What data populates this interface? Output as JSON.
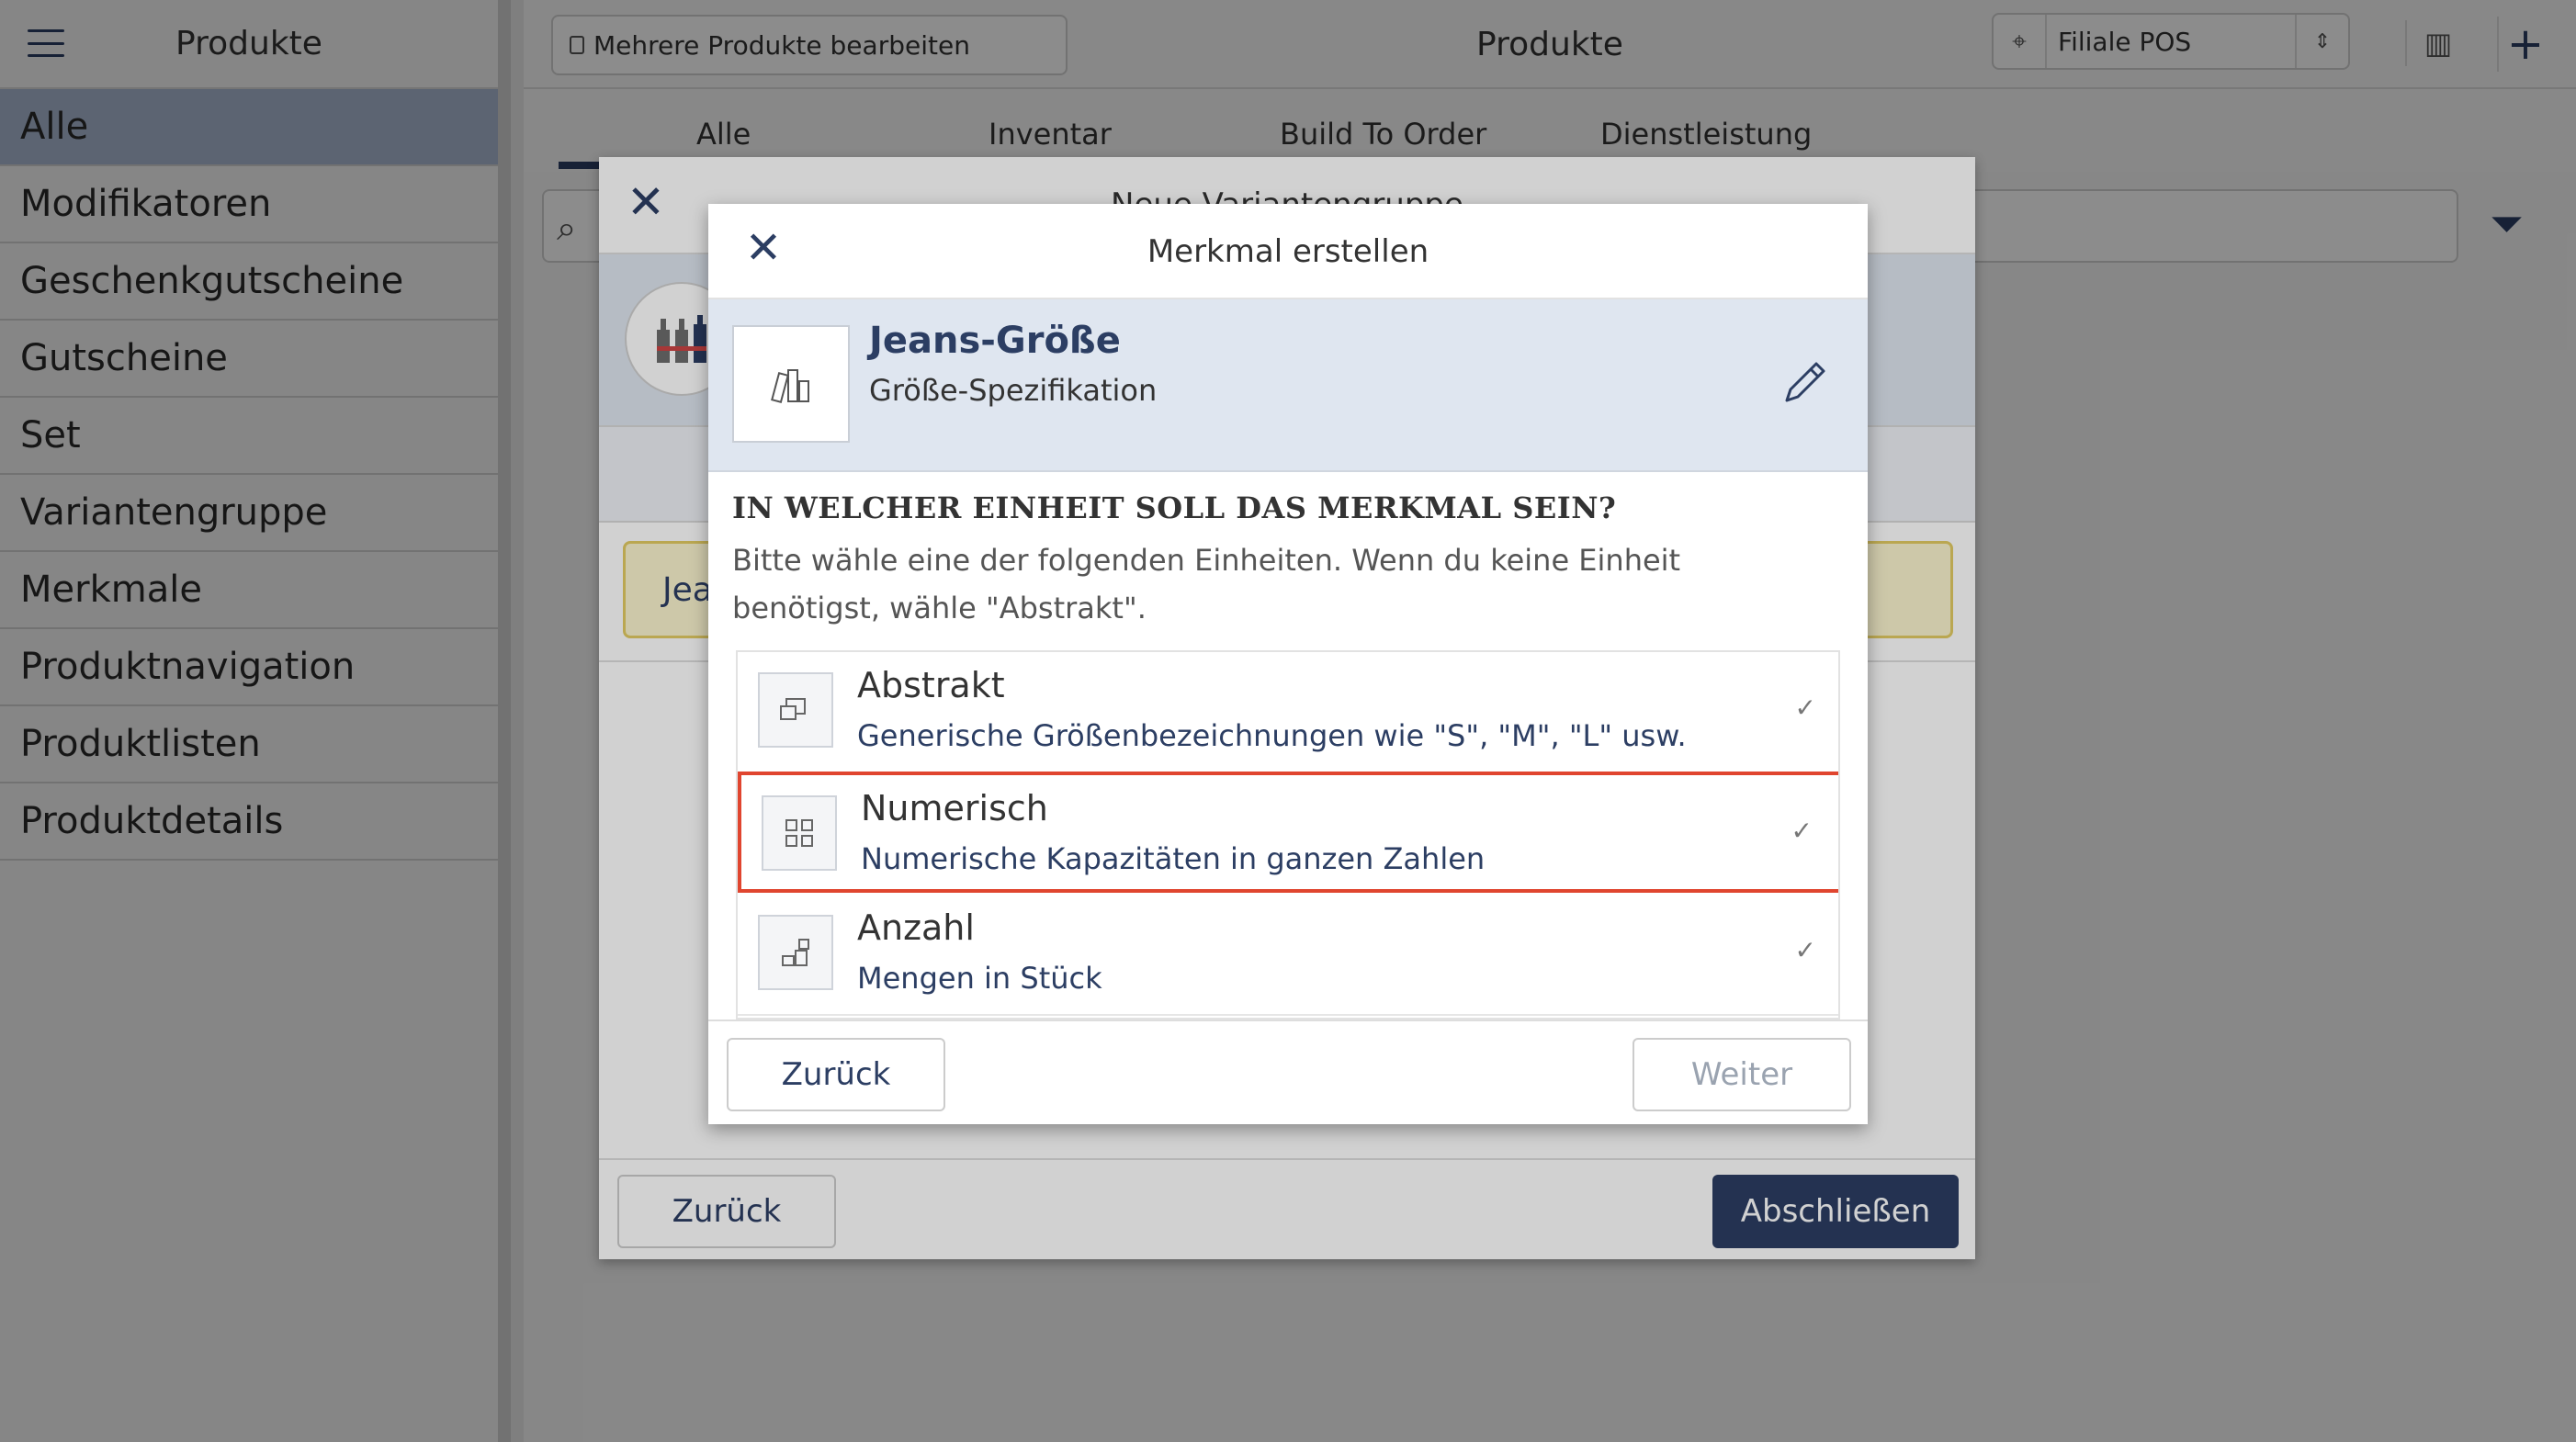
{
  "sidebar": {
    "title": "Produkte",
    "items": [
      {
        "label": "Alle"
      },
      {
        "label": "Modifikatoren"
      },
      {
        "label": "Geschenkgutscheine"
      },
      {
        "label": "Gutscheine"
      },
      {
        "label": "Set"
      },
      {
        "label": "Variantengruppe"
      },
      {
        "label": "Merkmale"
      },
      {
        "label": "Produktnavigation"
      },
      {
        "label": "Produktlisten"
      },
      {
        "label": "Produktdetails"
      }
    ]
  },
  "topbar": {
    "bulk_edit_label": "Mehrere Produkte bearbeiten",
    "title": "Produkte",
    "store_select_value": "Filiale POS"
  },
  "tabs": [
    {
      "label": "Alle"
    },
    {
      "label": "Inventar"
    },
    {
      "label": "Build To Order"
    },
    {
      "label": "Dienstleistung"
    }
  ],
  "variant_dialog": {
    "title": "Neue Variantengruppe",
    "yellow_text": "Jea",
    "back_label": "Zurück",
    "finish_label": "Abschließen"
  },
  "attribute_dialog": {
    "title": "Merkmal erstellen",
    "attribute_name": "Jeans-Größe",
    "attribute_subtitle": "Größe-Spezifikation",
    "question": "IN WELCHER EINHEIT SOLL DAS MERKMAL SEIN?",
    "help_text": "Bitte wähle eine der folgenden Einheiten. Wenn du keine Einheit benötigst, wähle \"Abstrakt\".",
    "options": [
      {
        "title": "Abstrakt",
        "description": "Generische Größenbezeichnungen wie \"S\", \"M\", \"L\" usw.",
        "icon": "abstract-icon",
        "selected": false
      },
      {
        "title": "Numerisch",
        "description": "Numerische Kapazitäten in ganzen Zahlen",
        "icon": "numeric-icon",
        "selected": true
      },
      {
        "title": "Anzahl",
        "description": "Mengen in Stück",
        "icon": "quantity-icon",
        "selected": false
      }
    ],
    "back_label": "Zurück",
    "next_label": "Weiter"
  },
  "colors": {
    "accent": "#2c3e63",
    "highlight": "#e0452f",
    "sidebar_active": "#a9b8d1",
    "band": "#dfe6f0"
  }
}
